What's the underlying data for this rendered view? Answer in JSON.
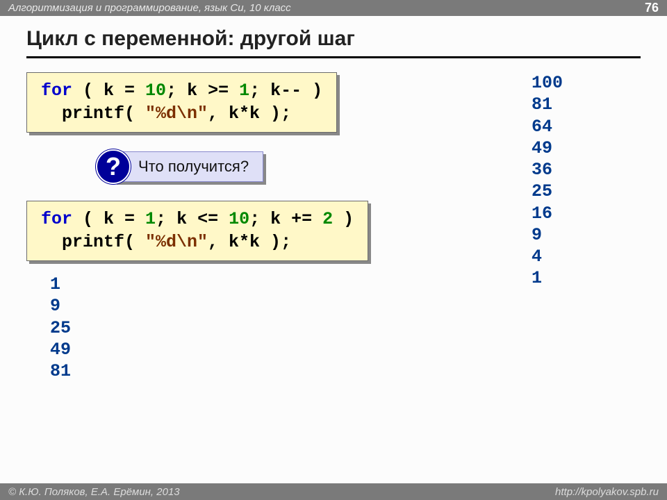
{
  "header": {
    "breadcrumb": "Алгоритмизация и программирование, язык Си, 10 класс",
    "page": "76"
  },
  "title": "Цикл с переменной: другой шаг",
  "code1": {
    "t1": "for",
    "t2": " ( k",
    "t3": " = ",
    "n1": "10",
    "t4": "; k",
    "t5": " >= ",
    "n2": "1",
    "t6": "; k",
    "t7": "--",
    "t8": " )",
    "l2a": "  printf( ",
    "str": "\"%d\\n\"",
    "l2b": ", k*k );"
  },
  "callout": {
    "badge": "?",
    "text": "Что получится?"
  },
  "code2": {
    "t1": "for",
    "t2": " ( k",
    "t3": " = ",
    "n1": "1",
    "t4": "; k",
    "t5": " <= ",
    "n2": "10",
    "t6": "; k",
    "t7": " += ",
    "n3": "2",
    "t8": " )",
    "l2a": "  printf( ",
    "str": "\"%d\\n\"",
    "l2b": ", k*k );"
  },
  "output_right": "100\n81\n64\n49\n36\n25\n16\n9\n4\n1",
  "output_left": "1\n9\n25\n49\n81",
  "footer": {
    "copyright": "© К.Ю. Поляков, Е.А. Ерёмин, 2013",
    "url": "http://kpolyakov.spb.ru"
  }
}
